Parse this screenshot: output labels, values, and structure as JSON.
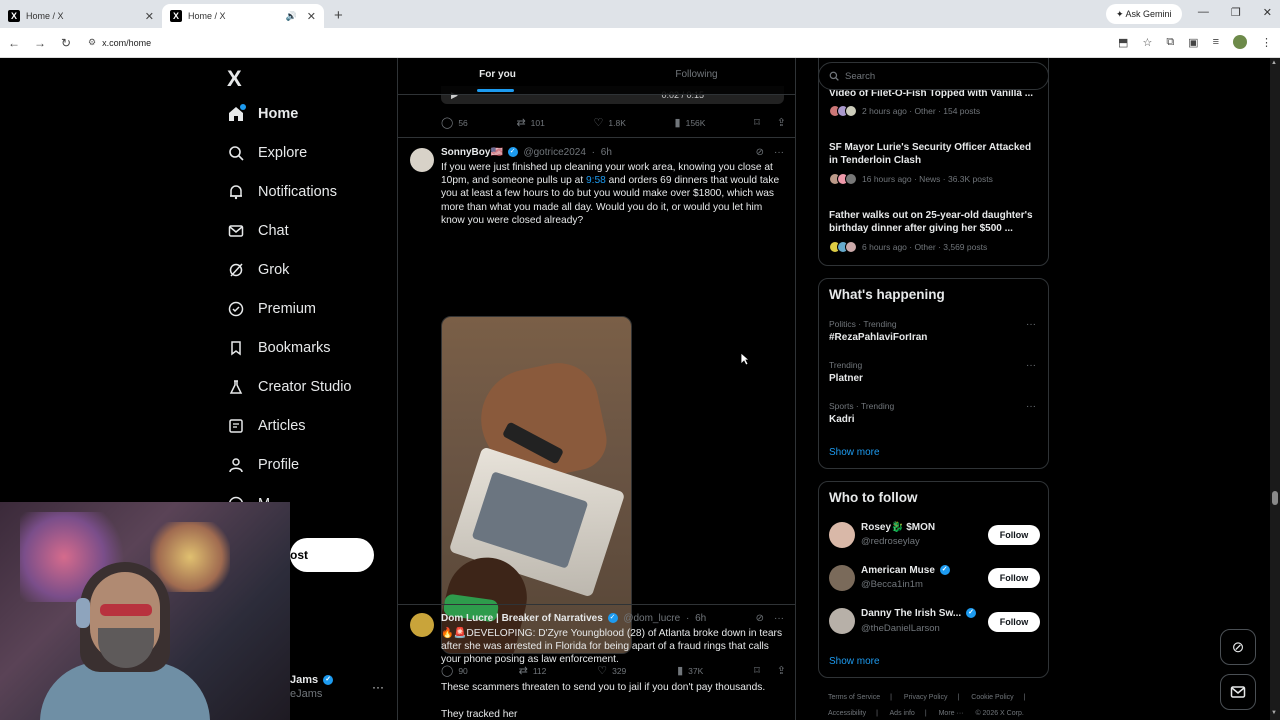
{
  "browser": {
    "tabs": [
      {
        "title": "Home / X",
        "favicon": "X",
        "active": false
      },
      {
        "title": "Home / X",
        "favicon": "X",
        "active": true
      }
    ],
    "ask_gemini": "Ask Gemini",
    "url": "x.com/home"
  },
  "leftnav": {
    "logo": "X",
    "items": [
      {
        "label": "Home",
        "icon": "home-icon"
      },
      {
        "label": "Explore",
        "icon": "search-icon"
      },
      {
        "label": "Notifications",
        "icon": "bell-icon"
      },
      {
        "label": "Chat",
        "icon": "mail-icon"
      },
      {
        "label": "Grok",
        "icon": "grok-icon"
      },
      {
        "label": "Premium",
        "icon": "verified-icon"
      },
      {
        "label": "Bookmarks",
        "icon": "bookmark-icon"
      },
      {
        "label": "Creator Studio",
        "icon": "flask-icon"
      },
      {
        "label": "Articles",
        "icon": "article-icon"
      },
      {
        "label": "Profile",
        "icon": "person-icon"
      },
      {
        "label": "M",
        "icon": "more-icon"
      }
    ],
    "post_label": "ost",
    "account_name": "Jams",
    "account_handle": "eJams"
  },
  "timeline": {
    "tabs": [
      "For you",
      "Following"
    ],
    "video_time": "0:02 / 0:15",
    "prev_tweet_stats": {
      "replies": "56",
      "reposts": "101",
      "likes": "1.8K",
      "views": "156K"
    },
    "tweets": [
      {
        "name": "SonnyBoy🇺🇸",
        "handle": "@gotrice2024",
        "time": "6h",
        "text_before": "If you were just finished up cleaning your work area, knowing you close at 10pm, and someone pulls up at ",
        "text_link": "9:58",
        "text_after": " and orders 69 dinners that would take you at least a few hours to do but you would make over $1800, which was more than what you made all day. Would you do it, or would you let him know you were closed already?",
        "stats": {
          "replies": "90",
          "reposts": "112",
          "likes": "329",
          "views": "37K"
        }
      },
      {
        "name": "Dom Lucre | Breaker of Narratives",
        "handle": "@dom_lucre",
        "time": "6h",
        "text": "🔥🚨DEVELOPING: D'Zyre Youngblood (28) of Atlanta broke down in tears after she was arrested in Florida for being apart of a fraud rings that calls your phone posing as law enforcement.",
        "text2": "These scammers threaten to send you to jail if you don't pay thousands.",
        "text3": "They tracked her"
      }
    ]
  },
  "rightcol": {
    "search_placeholder": "Search",
    "news": [
      {
        "title": "Video of Filet-O-Fish Topped with Vanilla ...",
        "meta": "2 hours ago · Other · 154 posts"
      },
      {
        "title": "SF Mayor Lurie's Security Officer Attacked in Tenderloin Clash",
        "meta": "16 hours ago · News · 36.3K posts"
      },
      {
        "title": "Father walks out on 25-year-old daughter's birthday dinner after giving her $500 ...",
        "meta": "6 hours ago · Other · 3,569 posts"
      }
    ],
    "whats_happening": {
      "title": "What's happening",
      "trends": [
        {
          "category": "Politics · Trending",
          "name": "#RezaPahlaviForIran"
        },
        {
          "category": "Trending",
          "name": "Platner"
        },
        {
          "category": "Sports · Trending",
          "name": "Kadri"
        }
      ],
      "show_more": "Show more"
    },
    "who_to_follow": {
      "title": "Who to follow",
      "accounts": [
        {
          "name": "Rosey🐉 $MON",
          "handle": "@redroseylay",
          "verified": false
        },
        {
          "name": "American Muse",
          "handle": "@Becca1in1m",
          "verified": true
        },
        {
          "name": "Danny The Irish Sw...",
          "handle": "@theDanielLarson",
          "verified": true
        }
      ],
      "follow_label": "Follow",
      "show_more": "Show more"
    },
    "footer": [
      "Terms of Service",
      "|",
      "Privacy Policy",
      "|",
      "Cookie Policy",
      "|",
      "Accessibility",
      "|",
      "Ads info",
      "|",
      "More ···",
      "© 2026 X Corp."
    ]
  }
}
